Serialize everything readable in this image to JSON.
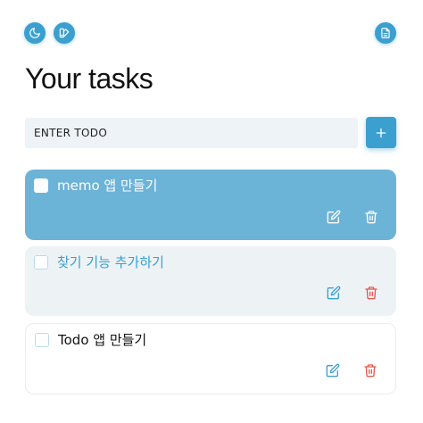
{
  "header": {
    "theme_icon": "moon-icon",
    "palette_icon": "palette-icon",
    "notes_icon": "document-icon"
  },
  "title": "Your tasks",
  "input": {
    "placeholder": "ENTER TODO",
    "value": "",
    "add_icon": "plus-icon"
  },
  "todos": [
    {
      "text": "memo 앱 만들기",
      "checked": false
    },
    {
      "text": "찾기 기능 추가하기",
      "checked": false
    },
    {
      "text": "Todo 앱 만들기",
      "checked": false
    }
  ],
  "colors": {
    "accent": "#3b9fd0",
    "selected_card": "#6cb3d8",
    "muted_card": "#edf2f5",
    "delete": "#e05a4f"
  }
}
